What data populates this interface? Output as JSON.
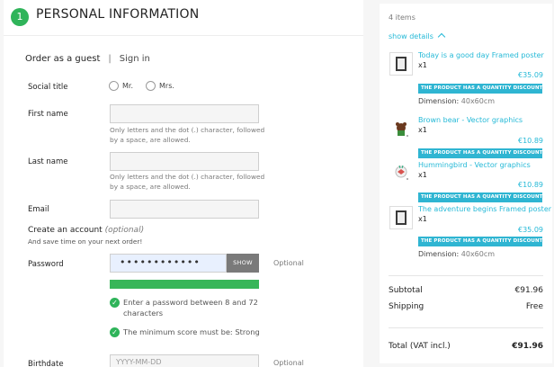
{
  "step": {
    "number": "1",
    "title": "PERSONAL INFORMATION"
  },
  "tabs": {
    "guest": "Order as a guest",
    "separator": "|",
    "signin": "Sign in"
  },
  "form": {
    "social_title_label": "Social title",
    "social_options": [
      "Mr.",
      "Mrs."
    ],
    "firstname_label": "First name",
    "firstname_hint": "Only letters and the dot (.) character, followed by a space, are allowed.",
    "lastname_label": "Last name",
    "lastname_hint": "Only letters and the dot (.) character, followed by a space, are allowed.",
    "email_label": "Email",
    "create_title": "Create an account",
    "create_optional": "(optional)",
    "create_sub": "And save time on your next order!",
    "password_label": "Password",
    "password_value": "••••••••••••",
    "show_label": "SHOW",
    "optional_label": "Optional",
    "check1": "Enter a password between 8 and 72 characters",
    "check2": "The minimum score must be: Strong",
    "birthdate_label": "Birthdate",
    "birthdate_placeholder": "YYYY-MM-DD",
    "birthdate_optional": "Optional"
  },
  "cart": {
    "items_count": "4 items",
    "show_details": "show details",
    "products": [
      {
        "name": "Today is a good day Framed poster",
        "qty": "x1",
        "price": "€35.09",
        "badge": "THE PRODUCT HAS A QUANTITY DISCOUNT",
        "dim_label": "Dimension:",
        "dim_value": "40x60cm"
      },
      {
        "name": "Brown bear - Vector graphics",
        "qty": "x1",
        "price": "€10.89",
        "badge": "THE PRODUCT HAS A QUANTITY DISCOUNT"
      },
      {
        "name": "Hummingbird - Vector graphics",
        "qty": "x1",
        "price": "€10.89",
        "badge": "THE PRODUCT HAS A QUANTITY DISCOUNT"
      },
      {
        "name": "The adventure begins Framed poster",
        "qty": "x1",
        "price": "€35.09",
        "badge": "THE PRODUCT HAS A QUANTITY DISCOUNT",
        "dim_label": "Dimension:",
        "dim_value": "40x60cm"
      }
    ],
    "subtotal_label": "Subtotal",
    "subtotal_value": "€91.96",
    "shipping_label": "Shipping",
    "shipping_value": "Free",
    "total_label": "Total (VAT incl.)",
    "total_value": "€91.96"
  },
  "colors": {
    "accent": "#25b9d7",
    "success": "#2fb45a",
    "badge": "#2fb5d2"
  }
}
